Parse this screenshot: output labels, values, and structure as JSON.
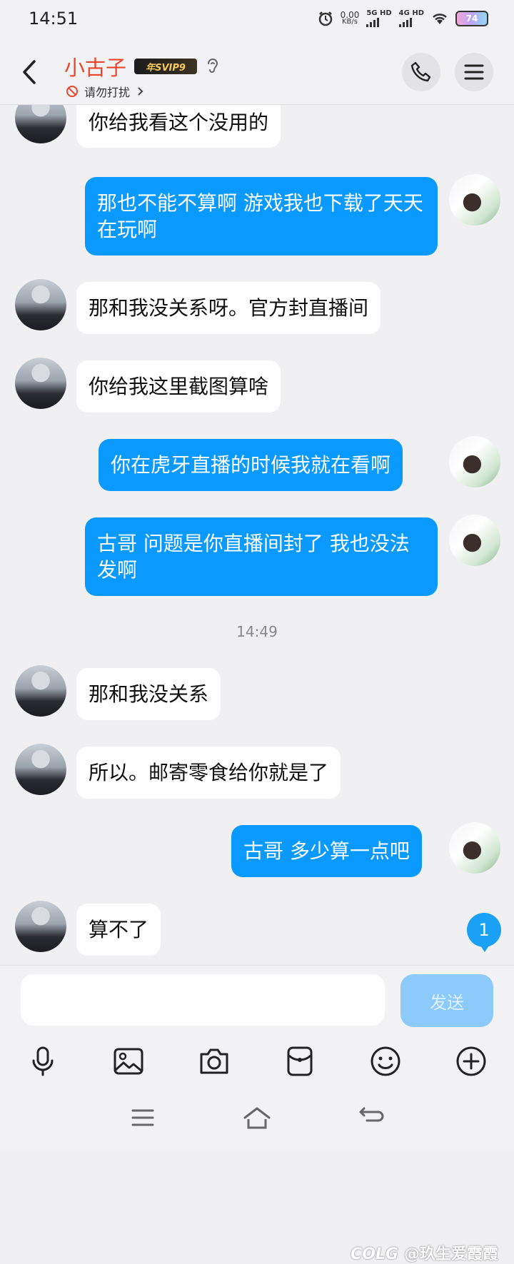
{
  "status_bar": {
    "time": "14:51",
    "net_speed": "0.00",
    "net_unit": "KB/s",
    "net1": "5G HD",
    "net2": "4G HD",
    "battery": "74"
  },
  "header": {
    "title": "小古子",
    "vip_badge": "年SVIP9",
    "status_text": "请勿打扰"
  },
  "messages": [
    {
      "side": "in",
      "text": "你给我看这个没用的"
    },
    {
      "side": "out",
      "text": "那也不能不算啊 游戏我也下载了天天在玩啊"
    },
    {
      "side": "in",
      "text": "那和我没关系呀。官方封直播间"
    },
    {
      "side": "in",
      "text": "你给我这里截图算啥"
    },
    {
      "side": "out",
      "text": "你在虎牙直播的时候我就在看啊"
    },
    {
      "side": "out",
      "text": "古哥 问题是你直播间封了 我也没法发啊"
    },
    {
      "timestamp": "14:49"
    },
    {
      "side": "in",
      "text": "那和我没关系"
    },
    {
      "side": "in",
      "text": "所以。邮寄零食给你就是了"
    },
    {
      "side": "out",
      "text": "古哥 多少算一点吧"
    },
    {
      "side": "in",
      "text": "算不了"
    }
  ],
  "unread_count": "1",
  "input": {
    "value": "",
    "placeholder": "",
    "send_label": "发送"
  },
  "toolbar_icons": [
    "microphone-icon",
    "image-icon",
    "camera-icon",
    "red-packet-icon",
    "emoji-icon",
    "plus-icon"
  ],
  "watermark": "@玖生爱霞霞",
  "watermark_logo": "COLG",
  "colors": {
    "outgoing_bubble": "#0a99ff",
    "incoming_bubble": "#ffffff",
    "title": "#e8472d",
    "send_disabled": "#8ccaf9"
  }
}
